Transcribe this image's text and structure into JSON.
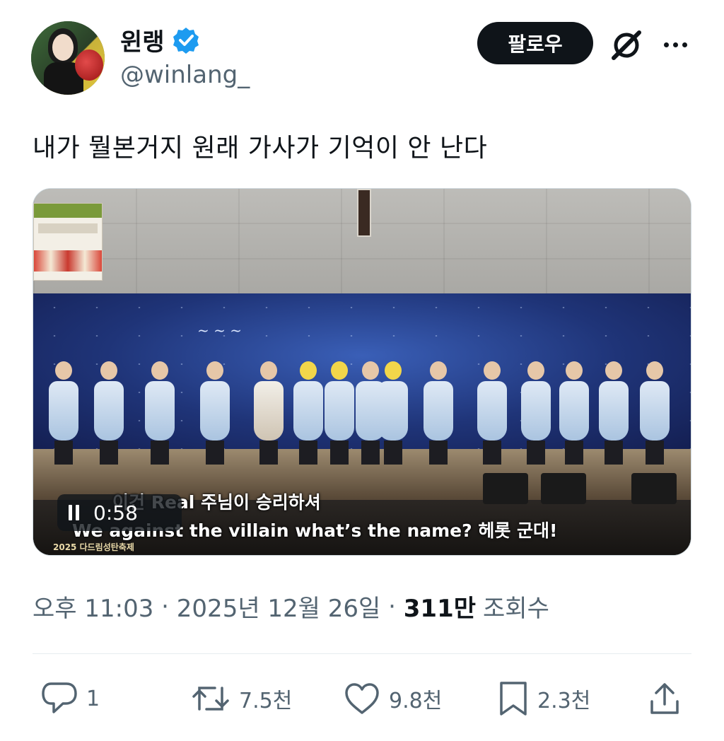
{
  "author": {
    "display_name": "윈랭",
    "handle": "@winlang_",
    "verified": true,
    "verified_color": "#1d9bf0"
  },
  "header": {
    "follow_label": "팔로우"
  },
  "tweet": {
    "text": "내가 뭘본거지 원래 가사가 기억이 안 난다"
  },
  "video": {
    "subtitle_line1": "이건 Real 주님이 승리하셔",
    "subtitle_line2": "We against the villain what’s the name? 헤롯 군대!",
    "event_label": "2025 다드림성탄축제",
    "time": "0:58",
    "state": "playing"
  },
  "meta": {
    "time": "오후 11:03",
    "separator": " · ",
    "date": "2025년 12월 26일",
    "views_count": "311만",
    "views_label": "조회수"
  },
  "actions": {
    "reply_count": "1",
    "retweet_count": "7.5천",
    "like_count": "9.8천",
    "bookmark_count": "2.3천"
  },
  "icons": {
    "avatar": "avatar",
    "verified": "verified-badge-icon",
    "grok": "grok-icon",
    "more": "more-icon",
    "pause": "pause-icon",
    "reply": "reply-icon",
    "retweet": "retweet-icon",
    "like": "heart-icon",
    "bookmark": "bookmark-icon",
    "share": "share-icon"
  }
}
